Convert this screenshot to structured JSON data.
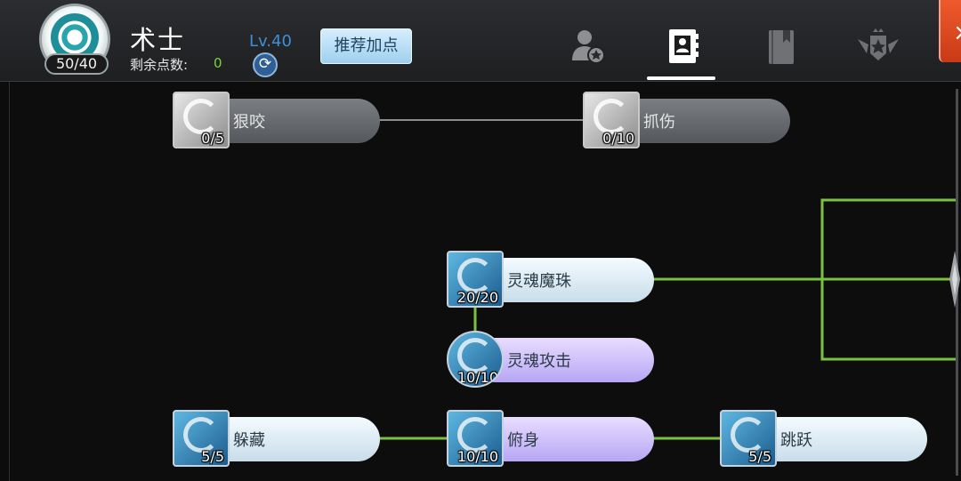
{
  "header": {
    "exp": "50/40",
    "class_name": "术士",
    "level": "Lv.40",
    "points_label": "剩余点数:",
    "points_value": "0",
    "recommend_label": "推荐加点",
    "tabs": [
      {
        "icon": "character-star-icon",
        "active": false
      },
      {
        "icon": "contact-book-icon",
        "active": true
      },
      {
        "icon": "bookmark-book-icon",
        "active": false
      },
      {
        "icon": "winged-star-emblem-icon",
        "active": false
      }
    ]
  },
  "skills": [
    {
      "name": "狠咬",
      "count": "0/5",
      "state": "locked"
    },
    {
      "name": "抓伤",
      "count": "0/10",
      "state": "locked"
    },
    {
      "name": "灵魂魔珠",
      "count": "20/20",
      "state": "learned"
    },
    {
      "name": "灵魂攻击",
      "count": "10/10",
      "state": "learned"
    },
    {
      "name": "躲藏",
      "count": "5/5",
      "state": "learned"
    },
    {
      "name": "俯身",
      "count": "10/10",
      "state": "learned"
    },
    {
      "name": "跳跃",
      "count": "5/5",
      "state": "learned"
    }
  ],
  "colors": {
    "active_link": "#7ac043",
    "inactive_link": "#8a8c8f",
    "level": "#3f8fd8",
    "points": "#7bd33a"
  }
}
